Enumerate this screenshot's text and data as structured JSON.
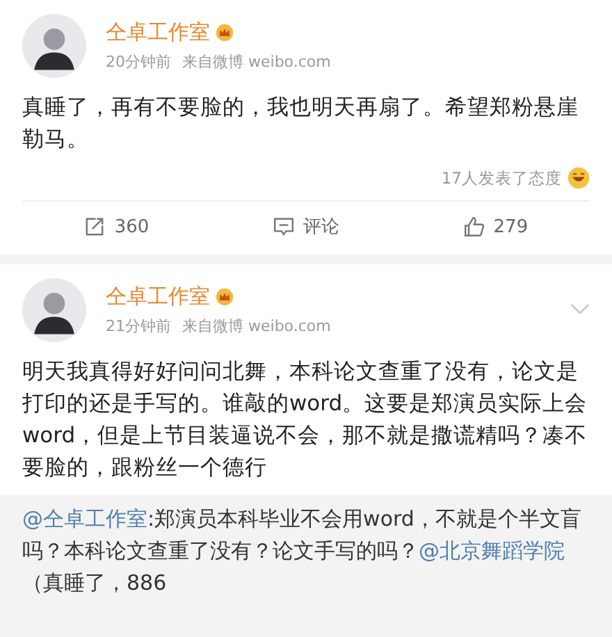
{
  "posts": [
    {
      "author": "仝卓工作室",
      "time": "20分钟前",
      "source": "来自微博 weibo.com",
      "text": "真睡了，再有不要脸的，我也明天再扇了。希望郑粉悬崖勒马。",
      "reactions": "17人发表了态度",
      "actions": [
        {
          "kind": "repost",
          "label": "360"
        },
        {
          "kind": "comment",
          "label": "评论"
        },
        {
          "kind": "like",
          "label": "279"
        }
      ]
    },
    {
      "author": "仝卓工作室",
      "time": "21分钟前",
      "source": "来自微博 weibo.com",
      "text": "明天我真得好好问问北舞，本科论文查重了没有，论文是打印的还是手写的。谁敲的word。这要是郑演员实际上会word，但是上节目装逼说不会，那不就是撒谎精吗？凑不要脸的，跟粉丝一个德行",
      "quote": [
        {
          "kind": "mention",
          "text": "@仝卓工作室"
        },
        {
          "kind": "text",
          "text": ":郑演员本科毕业不会用word，不就是个半文盲吗？本科论文查重了没有？论文手写的吗？"
        },
        {
          "kind": "mention",
          "text": "@北京舞蹈学院"
        },
        {
          "kind": "text",
          "text": "　（真睡了，886"
        }
      ]
    }
  ]
}
